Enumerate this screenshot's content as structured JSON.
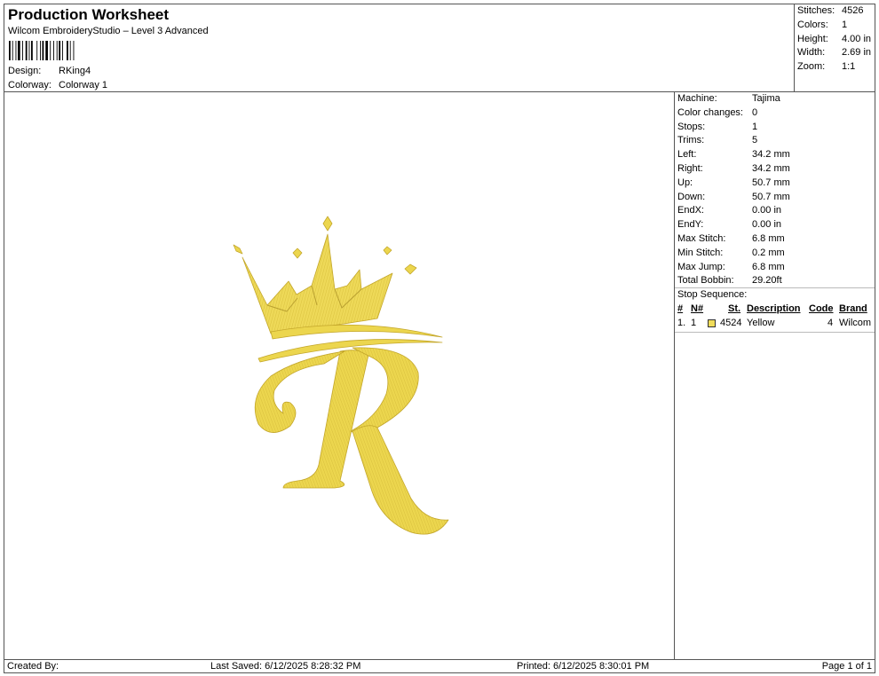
{
  "header": {
    "title": "Production Worksheet",
    "subtitle": "Wilcom EmbroideryStudio – Level 3 Advanced",
    "design_label": "Design:",
    "design_value": "RKing4",
    "colorway_label": "Colorway:",
    "colorway_value": "Colorway 1"
  },
  "summary": [
    {
      "label": "Stitches:",
      "value": "4526"
    },
    {
      "label": "Colors:",
      "value": "1"
    },
    {
      "label": "Height:",
      "value": "4.00 in"
    },
    {
      "label": "Width:",
      "value": "2.69 in"
    },
    {
      "label": "Zoom:",
      "value": "1:1"
    }
  ],
  "details": [
    {
      "label": "Machine:",
      "value": "Tajima"
    },
    {
      "label": "Color changes:",
      "value": "0"
    },
    {
      "label": "Stops:",
      "value": "1"
    },
    {
      "label": "Trims:",
      "value": "5"
    },
    {
      "label": "Left:",
      "value": "34.2 mm"
    },
    {
      "label": "Right:",
      "value": "34.2 mm"
    },
    {
      "label": "Up:",
      "value": "50.7 mm"
    },
    {
      "label": "Down:",
      "value": "50.7 mm"
    },
    {
      "label": "EndX:",
      "value": "0.00 in"
    },
    {
      "label": "EndY:",
      "value": "0.00 in"
    },
    {
      "label": "Max Stitch:",
      "value": "6.8 mm"
    },
    {
      "label": "Min Stitch:",
      "value": "0.2 mm"
    },
    {
      "label": "Max Jump:",
      "value": "6.8 mm"
    },
    {
      "label": "Total Bobbin:",
      "value": "29.20ft"
    }
  ],
  "stop_sequence": {
    "title": "Stop Sequence:",
    "columns": [
      "#",
      "N#",
      "St.",
      "Description",
      "Code",
      "Brand"
    ],
    "rows": [
      {
        "index": "1.",
        "needle": "1",
        "stitches": "4524",
        "description": "Yellow",
        "code": "4",
        "brand": "Wilcom",
        "color": "#f0dc5a"
      }
    ]
  },
  "footer": {
    "created_by": "Created By:",
    "last_saved": "Last Saved: 6/12/2025 8:28:32 PM",
    "printed": "Printed: 6/12/2025 8:30:01 PM",
    "page": "Page 1 of 1"
  },
  "design_colors": {
    "thread_main": "#ecd64e",
    "thread_shadow": "#c9ae2c",
    "thread_light": "#f6e784"
  }
}
